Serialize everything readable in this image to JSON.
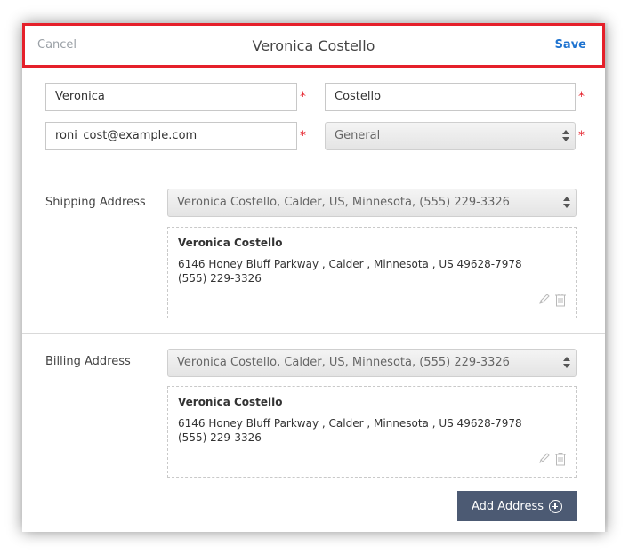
{
  "header": {
    "cancel_label": "Cancel",
    "title": "Veronica Costello",
    "save_label": "Save"
  },
  "form": {
    "first_name": "Veronica",
    "last_name": "Costello",
    "email": "roni_cost@example.com",
    "group": "General",
    "required_mark": "*"
  },
  "shipping": {
    "label": "Shipping Address",
    "selected": "Veronica Costello, Calder, US, Minnesota, (555) 229-3326",
    "card": {
      "name": "Veronica Costello",
      "line1": "6146 Honey Bluff Parkway , Calder , Minnesota , US 49628-7978",
      "line2": "(555) 229-3326"
    }
  },
  "billing": {
    "label": "Billing Address",
    "selected": "Veronica Costello, Calder, US, Minnesota, (555) 229-3326",
    "card": {
      "name": "Veronica Costello",
      "line1": "6146 Honey Bluff Parkway , Calder , Minnesota , US 49628-7978",
      "line2": "(555) 229-3326"
    }
  },
  "actions": {
    "add_address_label": "Add Address"
  },
  "colors": {
    "accent": "#1e73d0",
    "required": "#e5202a",
    "button_bg": "#4c5a73",
    "highlight_border": "#e5202a"
  }
}
